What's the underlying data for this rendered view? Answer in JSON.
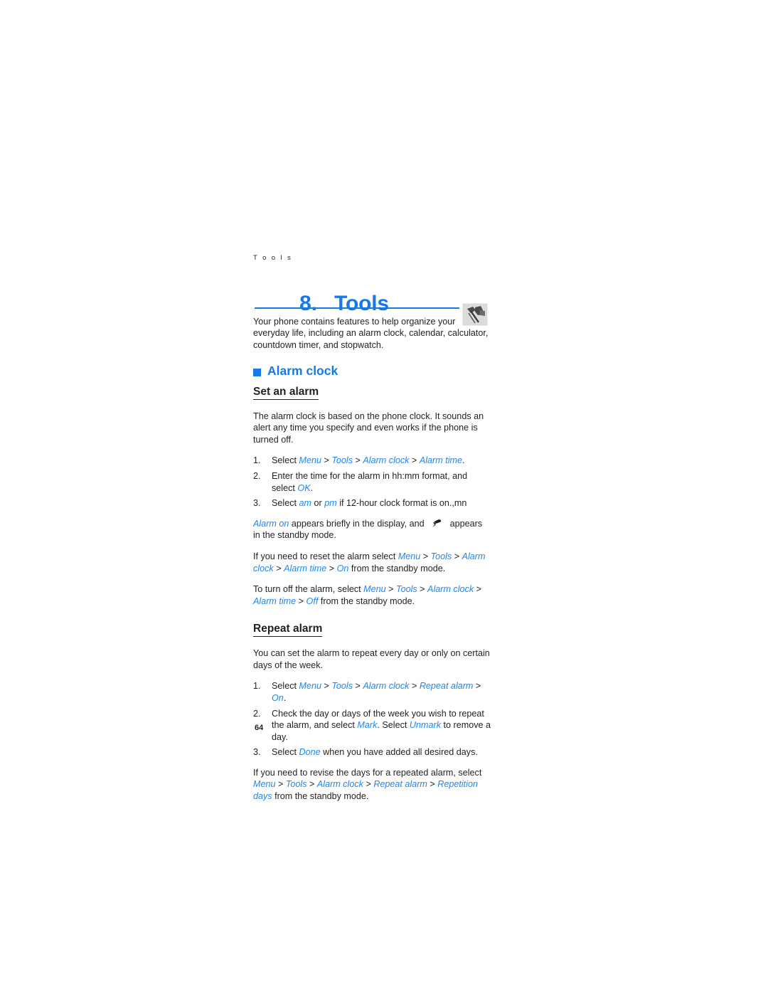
{
  "document": {
    "running_header": "T o o l s",
    "page_number": "64",
    "colors": {
      "accent_blue": "#1878e6",
      "ui_term_blue": "#1f86ef",
      "body_text": "#231f20",
      "page_background": "#ffffff"
    }
  },
  "chapter": {
    "number": "8.",
    "title": "Tools",
    "thumbnail_icon": "tools-hammer-thumbnail",
    "intro": "Your phone contains features to help organize your everyday life, including an alarm clock, calendar, calculator, countdown timer, and stopwatch."
  },
  "sections": [
    {
      "bullet_icon": "blue-square-bullet",
      "heading": "Alarm clock",
      "subsections": [
        {
          "heading": "Set an alarm",
          "intro": "The alarm clock is based on the phone clock. It sounds an alert any time you specify and even works if the phone is turned off.",
          "steps": [
            {
              "number": "1.",
              "parts": [
                {
                  "t": "Select ",
                  "s": "plain"
                },
                {
                  "t": "Menu",
                  "s": "ui"
                },
                {
                  "t": " > ",
                  "s": "sep"
                },
                {
                  "t": "Tools",
                  "s": "ui"
                },
                {
                  "t": " > ",
                  "s": "sep"
                },
                {
                  "t": "Alarm clock",
                  "s": "ui"
                },
                {
                  "t": " > ",
                  "s": "sep"
                },
                {
                  "t": "Alarm time",
                  "s": "ui"
                },
                {
                  "t": ".",
                  "s": "plain"
                }
              ]
            },
            {
              "number": "2.",
              "parts": [
                {
                  "t": "Enter the time for the alarm in hh:mm format, and select ",
                  "s": "plain"
                },
                {
                  "t": "OK",
                  "s": "ui"
                },
                {
                  "t": ".",
                  "s": "plain"
                }
              ]
            },
            {
              "number": "3.",
              "parts": [
                {
                  "t": "Select ",
                  "s": "plain"
                },
                {
                  "t": "am",
                  "s": "ui"
                },
                {
                  "t": " or ",
                  "s": "plain"
                },
                {
                  "t": "pm",
                  "s": "ui"
                },
                {
                  "t": " if 12-hour clock format is on.,mn",
                  "s": "plain"
                }
              ]
            }
          ],
          "notes": [
            {
              "parts": [
                {
                  "t": "Alarm on",
                  "s": "ui"
                },
                {
                  "t": " appears briefly in the display, and ",
                  "s": "plain"
                },
                {
                  "t": "",
                  "s": "bell-icon"
                },
                {
                  "t": " appears in the standby mode.",
                  "s": "plain"
                }
              ]
            },
            {
              "parts": [
                {
                  "t": "If you need to reset the alarm select ",
                  "s": "plain"
                },
                {
                  "t": "Menu",
                  "s": "ui"
                },
                {
                  "t": " > ",
                  "s": "sep"
                },
                {
                  "t": "Tools",
                  "s": "ui"
                },
                {
                  "t": " > ",
                  "s": "sep"
                },
                {
                  "t": "Alarm clock",
                  "s": "ui"
                },
                {
                  "t": " > ",
                  "s": "sep"
                },
                {
                  "t": "Alarm time",
                  "s": "ui"
                },
                {
                  "t": " > ",
                  "s": "sep"
                },
                {
                  "t": "On",
                  "s": "ui"
                },
                {
                  "t": " from the standby mode.",
                  "s": "plain"
                }
              ]
            },
            {
              "parts": [
                {
                  "t": "To turn off the alarm, select ",
                  "s": "plain"
                },
                {
                  "t": "Menu",
                  "s": "ui"
                },
                {
                  "t": " > ",
                  "s": "sep"
                },
                {
                  "t": "Tools",
                  "s": "ui"
                },
                {
                  "t": " > ",
                  "s": "sep"
                },
                {
                  "t": "Alarm clock",
                  "s": "ui"
                },
                {
                  "t": " > ",
                  "s": "sep"
                },
                {
                  "t": "Alarm time",
                  "s": "ui"
                },
                {
                  "t": " > ",
                  "s": "sep"
                },
                {
                  "t": "Off",
                  "s": "ui"
                },
                {
                  "t": " from the standby mode.",
                  "s": "plain"
                }
              ]
            }
          ]
        },
        {
          "heading": "Repeat alarm",
          "intro": "You can set the alarm to repeat every day or only on certain days of the week.",
          "steps": [
            {
              "number": "1.",
              "parts": [
                {
                  "t": "Select ",
                  "s": "plain"
                },
                {
                  "t": "Menu",
                  "s": "ui"
                },
                {
                  "t": " > ",
                  "s": "sep"
                },
                {
                  "t": "Tools",
                  "s": "ui"
                },
                {
                  "t": " > ",
                  "s": "sep"
                },
                {
                  "t": "Alarm clock",
                  "s": "ui"
                },
                {
                  "t": " > ",
                  "s": "sep"
                },
                {
                  "t": "Repeat alarm",
                  "s": "ui"
                },
                {
                  "t": " > ",
                  "s": "sep"
                },
                {
                  "t": "On",
                  "s": "ui"
                },
                {
                  "t": ".",
                  "s": "plain"
                }
              ]
            },
            {
              "number": "2.",
              "parts": [
                {
                  "t": "Check the day or days of the week you wish to repeat the alarm, and select ",
                  "s": "plain"
                },
                {
                  "t": "Mark",
                  "s": "ui"
                },
                {
                  "t": ". Select ",
                  "s": "plain"
                },
                {
                  "t": "Unmark",
                  "s": "ui"
                },
                {
                  "t": " to remove a day.",
                  "s": "plain"
                }
              ]
            },
            {
              "number": "3.",
              "parts": [
                {
                  "t": "Select ",
                  "s": "plain"
                },
                {
                  "t": "Done",
                  "s": "ui"
                },
                {
                  "t": " when you have added all desired days.",
                  "s": "plain"
                }
              ]
            }
          ],
          "notes": [
            {
              "parts": [
                {
                  "t": "If you need to revise the days for a repeated alarm, select ",
                  "s": "plain"
                },
                {
                  "t": "Menu",
                  "s": "ui"
                },
                {
                  "t": " > ",
                  "s": "sep"
                },
                {
                  "t": "Tools",
                  "s": "ui"
                },
                {
                  "t": " > ",
                  "s": "sep"
                },
                {
                  "t": "Alarm clock",
                  "s": "ui"
                },
                {
                  "t": " > ",
                  "s": "sep"
                },
                {
                  "t": "Repeat alarm",
                  "s": "ui"
                },
                {
                  "t": " > ",
                  "s": "sep"
                },
                {
                  "t": "Repetition days",
                  "s": "ui"
                },
                {
                  "t": " from the standby mode.",
                  "s": "plain"
                }
              ]
            }
          ]
        }
      ]
    }
  ]
}
